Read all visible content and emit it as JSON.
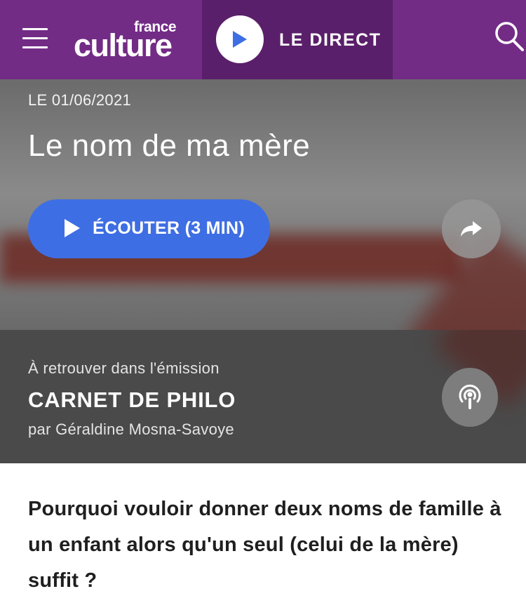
{
  "header": {
    "logo": {
      "small": "france",
      "big": "culture"
    },
    "direct_label": "LE DIRECT",
    "accent_color": "#732c86",
    "direct_bg_color": "#5a1f6a"
  },
  "episode": {
    "date": "LE 01/06/2021",
    "title": "Le nom de ma mère",
    "listen_label": "ÉCOUTER (3 MIN)",
    "listen_color": "#3e6ee3"
  },
  "show": {
    "intro": "À retrouver dans l'émission",
    "name": "CARNET DE PHILO",
    "author": "par Géraldine Mosna-Savoye"
  },
  "description": "Pourquoi vouloir donner deux noms de famille à un enfant alors qu'un seul (celui de la mère) suffit ?",
  "icons": [
    "menu-icon",
    "play-icon",
    "search-icon",
    "share-icon",
    "podcast-icon"
  ]
}
